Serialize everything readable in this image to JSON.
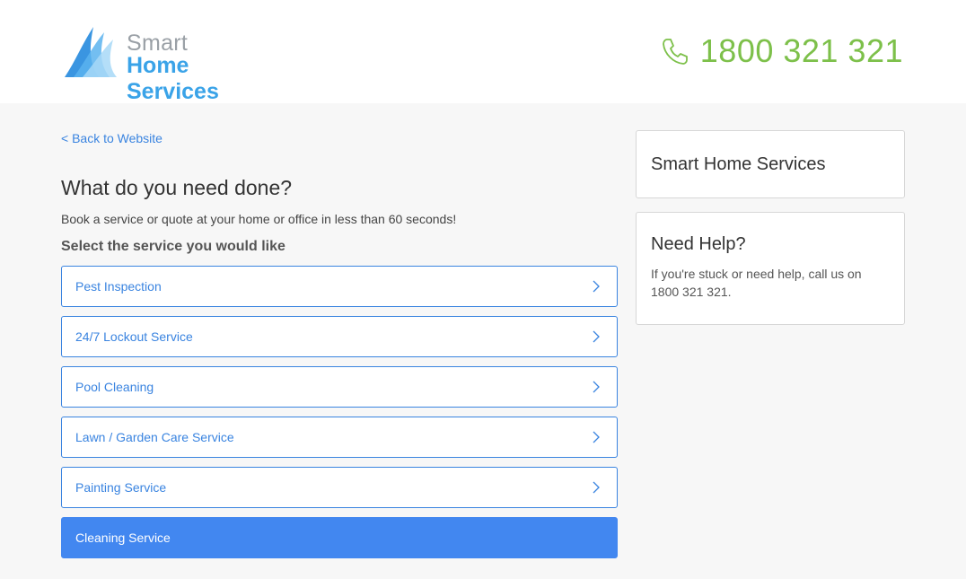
{
  "header": {
    "logo": {
      "line1": "Smart",
      "line2": "Home Services"
    },
    "phone": {
      "icon": "phone-icon",
      "number": "1800 321 321"
    }
  },
  "main": {
    "back_link": "< Back to Website",
    "title": "What do you need done?",
    "subtitle": "Book a service or quote at your home or office in less than 60 seconds!",
    "section_label": "Select the service you would like",
    "services": [
      {
        "label": "Pest Inspection",
        "selected": false
      },
      {
        "label": "24/7 Lockout Service",
        "selected": false
      },
      {
        "label": "Pool Cleaning",
        "selected": false
      },
      {
        "label": "Lawn / Garden Care Service",
        "selected": false
      },
      {
        "label": "Painting Service",
        "selected": false
      },
      {
        "label": "Cleaning Service",
        "selected": true
      }
    ]
  },
  "sidebar": {
    "company_name": "Smart Home Services",
    "help": {
      "title": "Need Help?",
      "text": "If you're stuck or need help, call us on 1800 321 321."
    }
  },
  "colors": {
    "accent_blue": "#3a84e0",
    "selected_blue": "#4287f0",
    "phone_green": "#7dc04a",
    "logo_blue": "#3aa3e8",
    "logo_gray": "#9aa0a6",
    "page_background": "#f7f7f7"
  }
}
